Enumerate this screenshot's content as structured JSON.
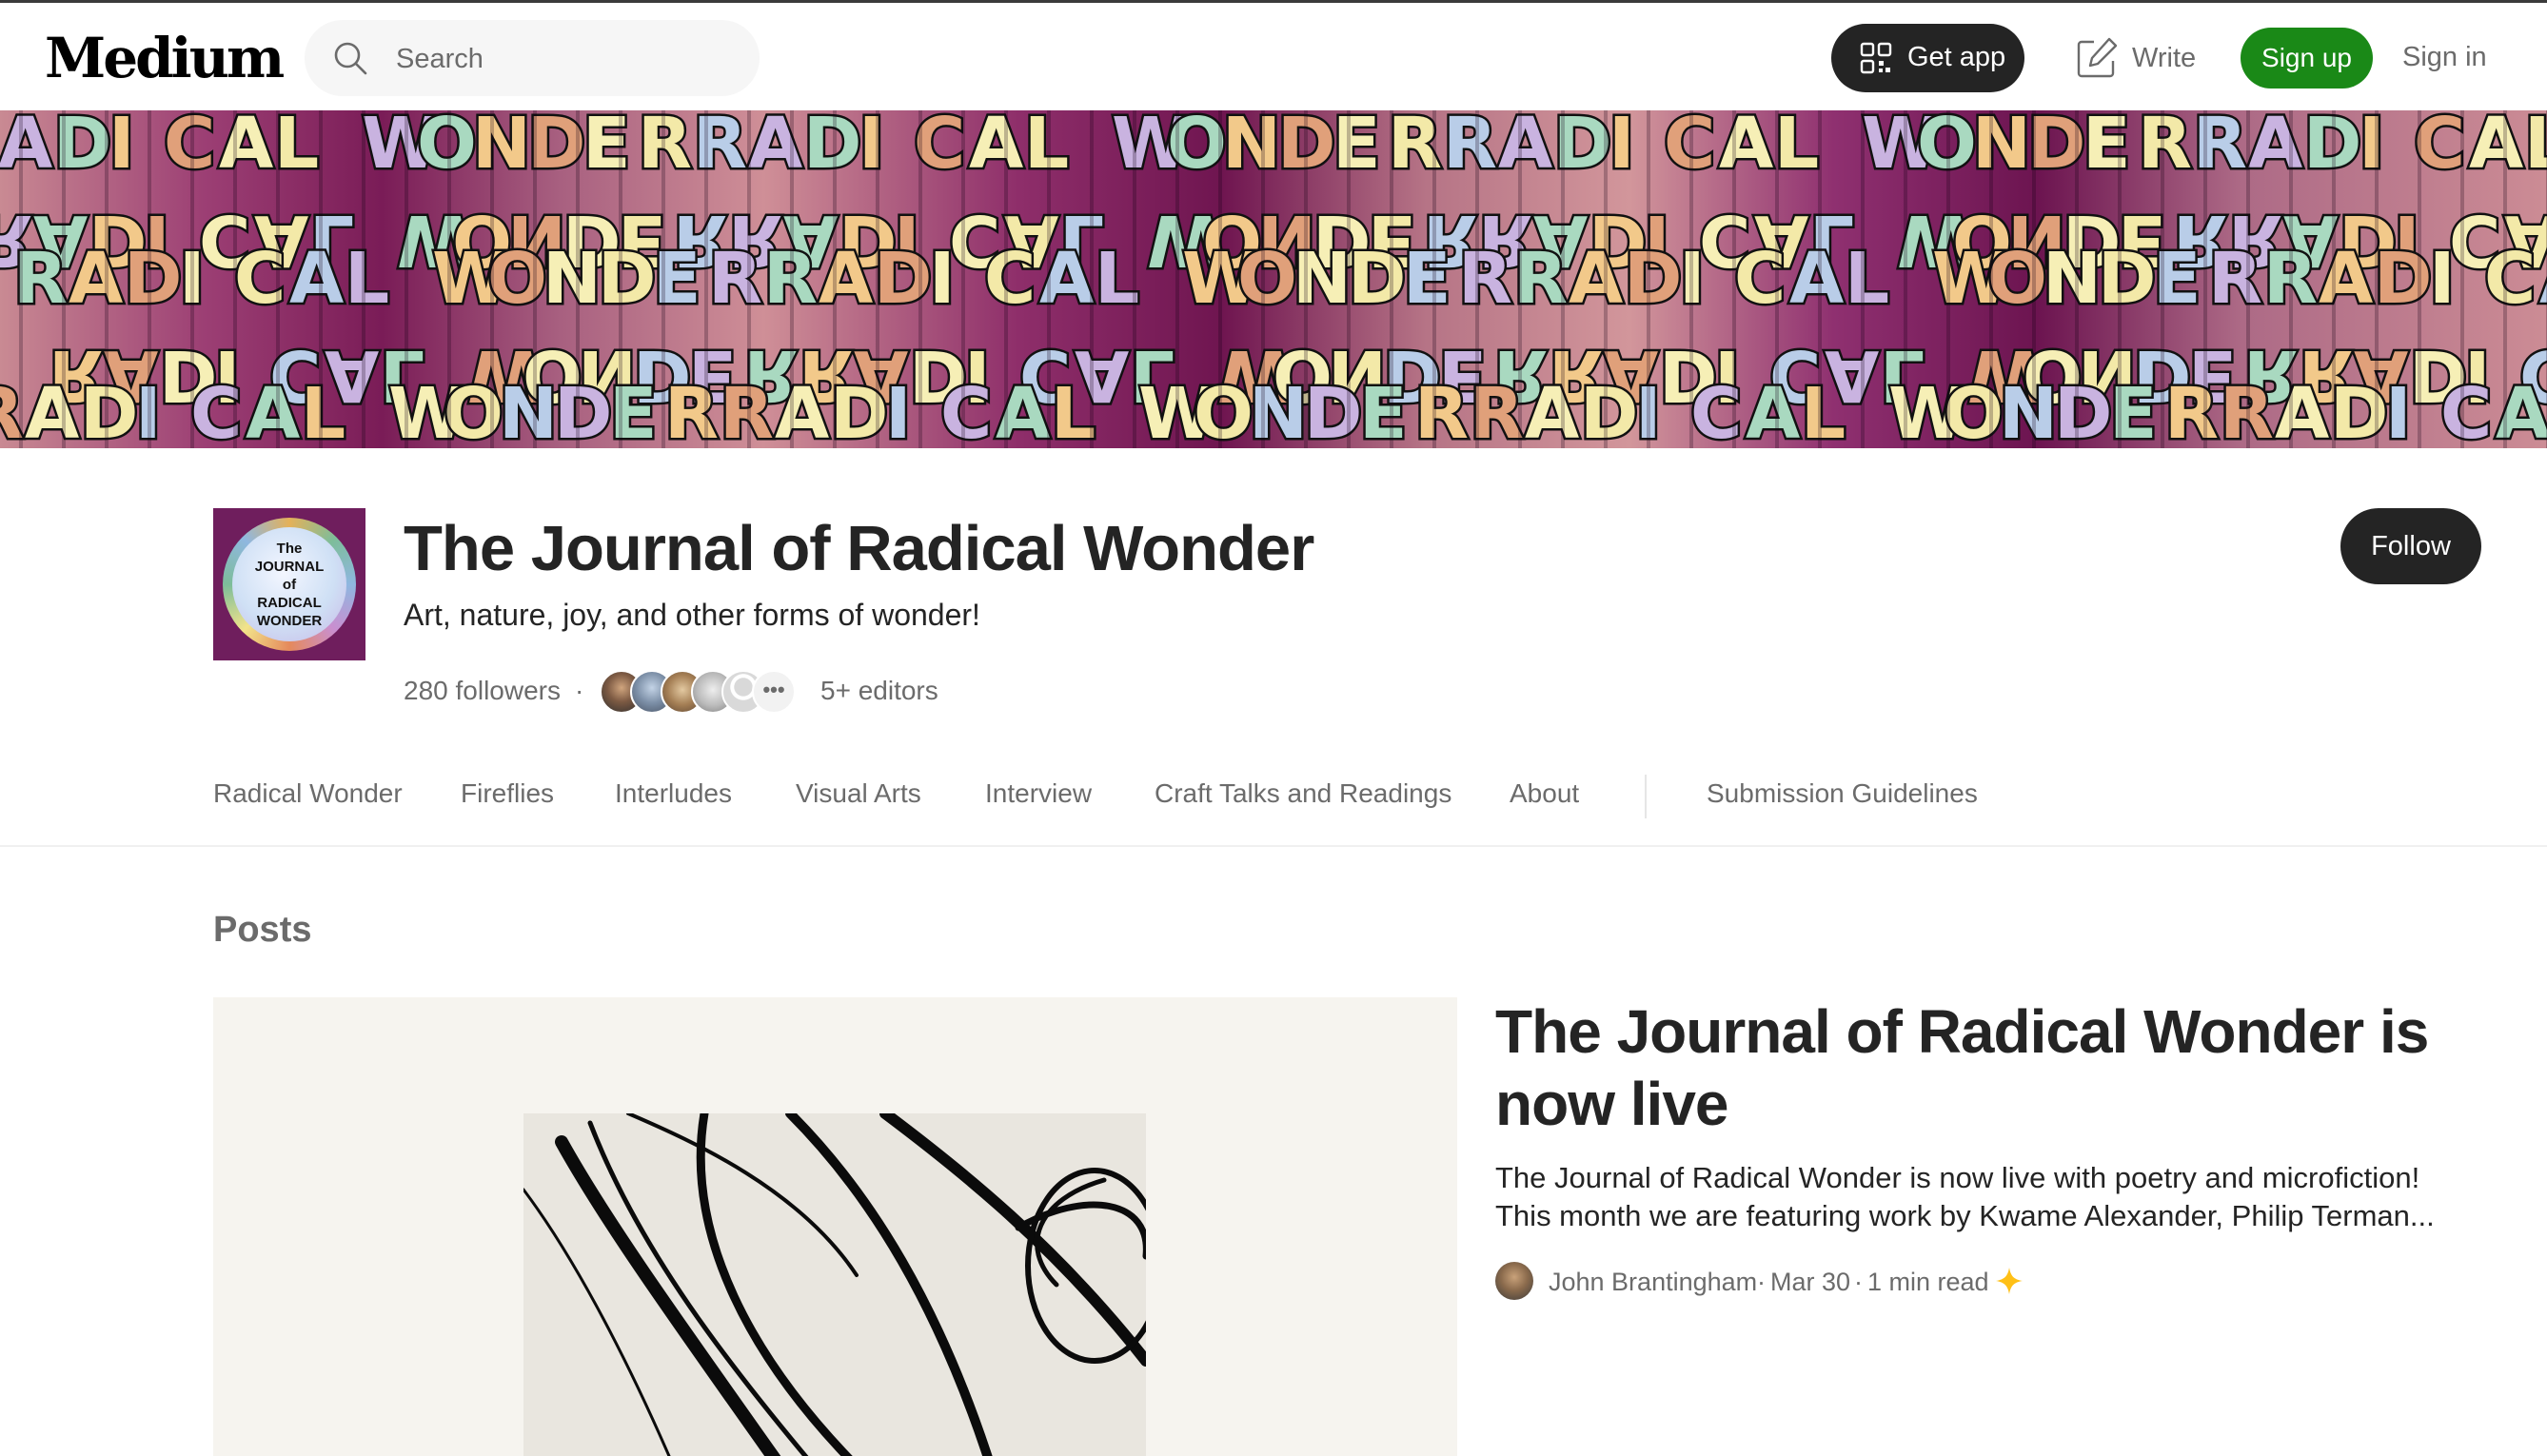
{
  "header": {
    "logo": "Medium",
    "search_placeholder": "Search",
    "get_app": "Get app",
    "write": "Write",
    "sign_up": "Sign up",
    "sign_in": "Sign in"
  },
  "banner": {
    "text": "RADICAL WONDER"
  },
  "publication": {
    "logo_text": "The\nJOURNAL\nof\nRADICAL\nWONDER",
    "title": "The Journal of Radical Wonder",
    "tagline": "Art, nature, joy, and other forms of wonder!",
    "followers": "280 followers",
    "separator": "·",
    "editors": "5+ editors",
    "follow": "Follow"
  },
  "tabs": [
    {
      "label": "Radical Wonder"
    },
    {
      "label": "Fireflies"
    },
    {
      "label": "Interludes"
    },
    {
      "label": "Visual Arts"
    },
    {
      "label": "Interview"
    },
    {
      "label": "Craft Talks and Readings"
    },
    {
      "label": "About"
    },
    {
      "label": "Submission Guidelines"
    }
  ],
  "posts": {
    "heading": "Posts",
    "featured": {
      "title": "The Journal of Radical Wonder is now live",
      "excerpt_line1": "The Journal of Radical Wonder is now live with poetry and microfiction!",
      "excerpt_line2": "This month we are featuring work by Kwame Alexander, Philip Terman...",
      "author": "John Brantingham",
      "date": "Mar 30",
      "read_time": "1 min read",
      "member_only_icon": "sparkle-star-icon"
    }
  },
  "colors": {
    "brand_green": "#1a8917",
    "dark_button": "#242424",
    "text_primary": "#242424",
    "text_secondary": "#6b6b6b",
    "member_star": "#ffc017"
  }
}
